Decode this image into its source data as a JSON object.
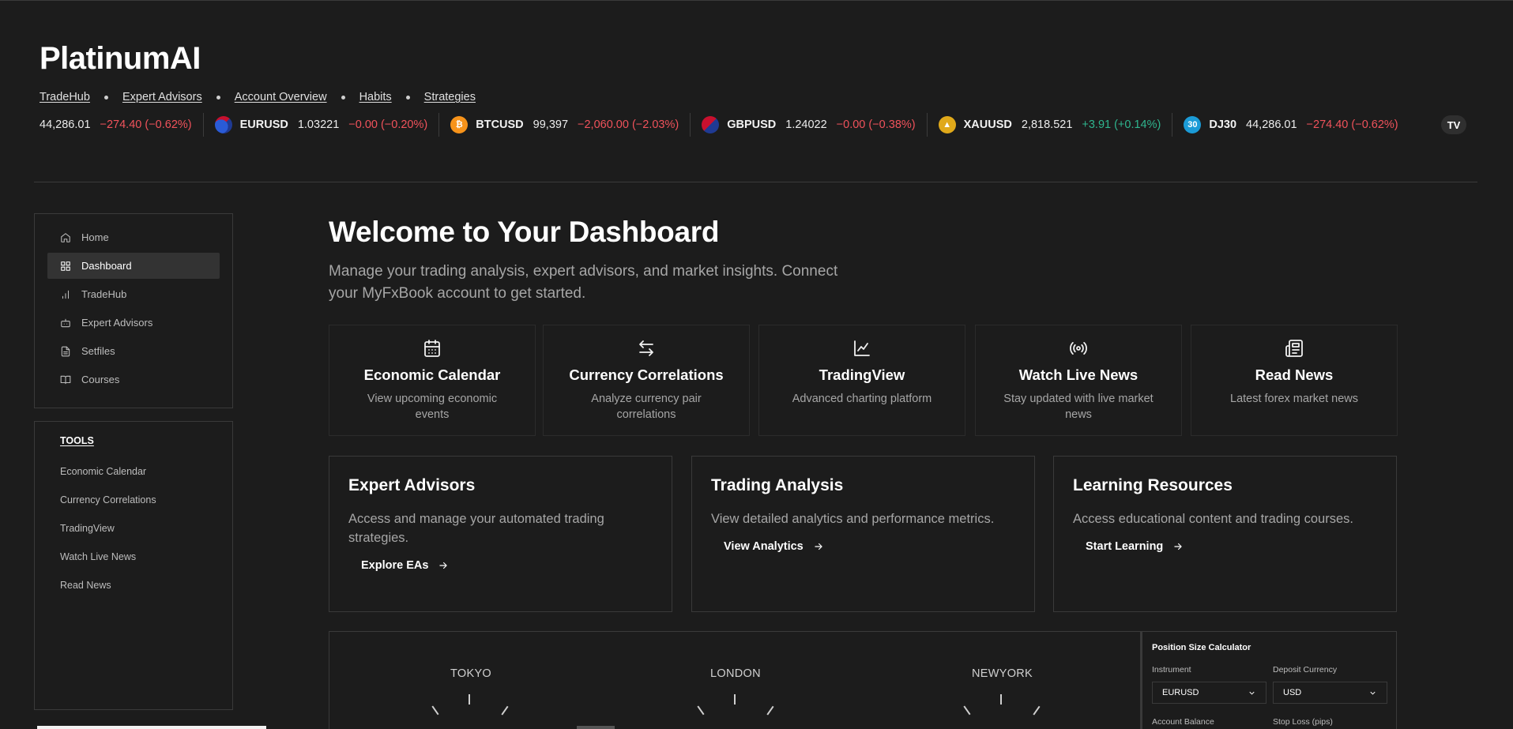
{
  "brand": "PlatinumAI",
  "topnav": [
    "TradeHub",
    "Expert Advisors",
    "Account Overview",
    "Habits",
    "Strategies"
  ],
  "ticker": [
    {
      "symbol": "",
      "price": "44,286.01",
      "change": "−274.40 (−0.62%)",
      "direction": "neg",
      "icon": ""
    },
    {
      "symbol": "EURUSD",
      "price": "1.03221",
      "change": "−0.00 (−0.20%)",
      "direction": "neg",
      "icon": "eu-us-flag-icon"
    },
    {
      "symbol": "BTCUSD",
      "price": "99,397",
      "change": "−2,060.00 (−2.03%)",
      "direction": "neg",
      "icon": "bitcoin-icon"
    },
    {
      "symbol": "GBPUSD",
      "price": "1.24022",
      "change": "−0.00 (−0.38%)",
      "direction": "neg",
      "icon": "gb-us-flag-icon"
    },
    {
      "symbol": "XAUUSD",
      "price": "2,818.521",
      "change": "+3.91 (+0.14%)",
      "direction": "pos",
      "icon": "gold-icon"
    },
    {
      "symbol": "DJ30",
      "price": "44,286.01",
      "change": "−274.40 (−0.62%)",
      "direction": "neg",
      "icon": "dj30-icon",
      "icon_text": "30"
    }
  ],
  "tv_logo": "TV",
  "sidebar": {
    "items": [
      {
        "label": "Home",
        "icon": "home-icon"
      },
      {
        "label": "Dashboard",
        "icon": "dashboard-icon",
        "active": true
      },
      {
        "label": "TradeHub",
        "icon": "bar-chart-icon"
      },
      {
        "label": "Expert Advisors",
        "icon": "robot-icon"
      },
      {
        "label": "Setfiles",
        "icon": "file-icon"
      },
      {
        "label": "Courses",
        "icon": "book-icon"
      }
    ]
  },
  "tools": {
    "title": "TOOLS",
    "items": [
      "Economic Calendar",
      "Currency Correlations",
      "TradingView",
      "Watch Live News",
      "Read News"
    ]
  },
  "main": {
    "title": "Welcome to Your Dashboard",
    "subtitle": "Manage your trading analysis, expert advisors, and market insights. Connect your MyFxBook account to get started."
  },
  "quick_links": [
    {
      "title": "Economic Calendar",
      "desc": "View upcoming economic events",
      "icon": "calendar-icon"
    },
    {
      "title": "Currency Correlations",
      "desc": "Analyze currency pair correlations",
      "icon": "arrows-swap-icon"
    },
    {
      "title": "TradingView",
      "desc": "Advanced charting platform",
      "icon": "line-chart-icon"
    },
    {
      "title": "Watch Live News",
      "desc": "Stay updated with live market news",
      "icon": "broadcast-icon"
    },
    {
      "title": "Read News",
      "desc": "Latest forex market news",
      "icon": "newspaper-icon"
    }
  ],
  "cards": [
    {
      "title": "Expert Advisors",
      "desc": "Access and manage your automated trading strategies.",
      "link": "Explore EAs"
    },
    {
      "title": "Trading Analysis",
      "desc": "View detailed analytics and performance metrics.",
      "link": "View Analytics"
    },
    {
      "title": "Learning Resources",
      "desc": "Access educational content and trading courses.",
      "link": "Start Learning"
    }
  ],
  "clocks": [
    "TOKYO",
    "LONDON",
    "NEWYORK"
  ],
  "calculator": {
    "title": "Position Size Calculator",
    "instrument_label": "Instrument",
    "instrument_value": "EURUSD",
    "deposit_label": "Deposit Currency",
    "deposit_value": "USD",
    "balance_label": "Account Balance",
    "stoploss_label": "Stop Loss (pips)"
  },
  "colors": {
    "background": "#1c1c1c",
    "negative": "#f0525b",
    "positive": "#2fb58e",
    "border": "#3a3a3a"
  }
}
